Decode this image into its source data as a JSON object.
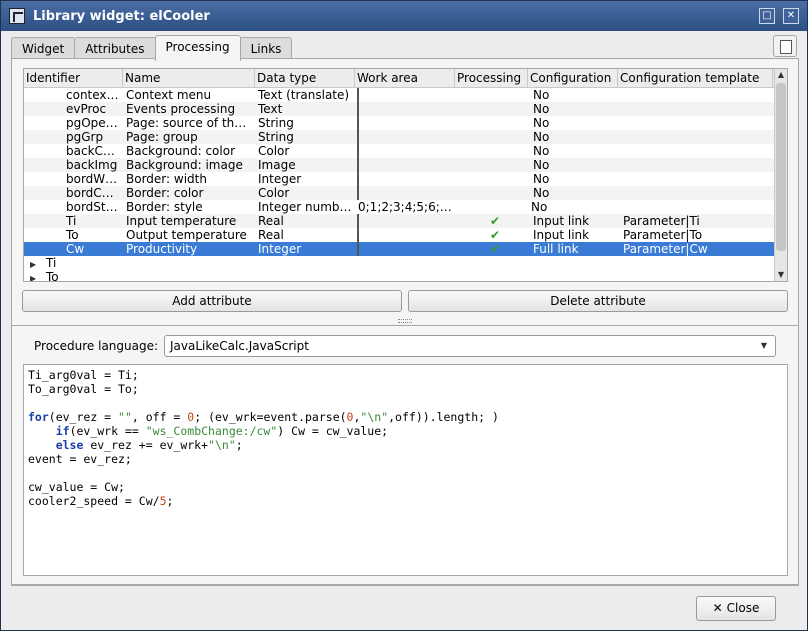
{
  "window": {
    "title": "Library widget: elCooler",
    "maximize_icon": "maximize-icon",
    "close_icon": "close-icon"
  },
  "tabs": [
    {
      "label": "Widget"
    },
    {
      "label": "Attributes"
    },
    {
      "label": "Processing",
      "active": true
    },
    {
      "label": "Links"
    }
  ],
  "table": {
    "headers": [
      "Identifier",
      "Name",
      "Data type",
      "Work area",
      "Processing",
      "Configuration",
      "Configuration template"
    ],
    "rows": [
      {
        "id": "contex…",
        "name": "Context menu",
        "type": "Text (translate)",
        "work": "",
        "proc": false,
        "conf": "No",
        "tmpl": ""
      },
      {
        "id": "evProc",
        "name": "Events processing",
        "type": "Text",
        "work": "",
        "proc": false,
        "conf": "No",
        "tmpl": ""
      },
      {
        "id": "pgOpe…",
        "name": "Page: source of th…",
        "type": "String",
        "work": "",
        "proc": false,
        "conf": "No",
        "tmpl": ""
      },
      {
        "id": "pgGrp",
        "name": "Page: group",
        "type": "String",
        "work": "",
        "proc": false,
        "conf": "No",
        "tmpl": ""
      },
      {
        "id": "backC…",
        "name": "Background: color",
        "type": "Color",
        "work": "",
        "proc": false,
        "conf": "No",
        "tmpl": ""
      },
      {
        "id": "backImg",
        "name": "Background: image",
        "type": "Image",
        "work": "",
        "proc": false,
        "conf": "No",
        "tmpl": ""
      },
      {
        "id": "bordW…",
        "name": "Border: width",
        "type": "Integer",
        "work": "",
        "proc": false,
        "conf": "No",
        "tmpl": ""
      },
      {
        "id": "bordC…",
        "name": "Border: color",
        "type": "Color",
        "work": "",
        "proc": false,
        "conf": "No",
        "tmpl": ""
      },
      {
        "id": "bordSt…",
        "name": "Border: style",
        "type": "Integer numb…",
        "work": "0;1;2;3;4;5;6;…",
        "proc": false,
        "conf": "No",
        "tmpl": ""
      },
      {
        "id": "Ti",
        "name": "Input temperature",
        "type": "Real",
        "work": "",
        "proc": true,
        "conf": "Input link",
        "tmpl": "Parameter|Ti"
      },
      {
        "id": "To",
        "name": "Output temperature",
        "type": "Real",
        "work": "",
        "proc": true,
        "conf": "Input link",
        "tmpl": "Parameter|To"
      },
      {
        "id": "Cw",
        "name": "Productivity",
        "type": "Integer",
        "work": "",
        "proc": true,
        "conf": "Full link",
        "tmpl": "Parameter|Cw",
        "selected": true
      }
    ],
    "tree": [
      "Ti",
      "To"
    ]
  },
  "buttons": {
    "add": "Add attribute",
    "delete": "Delete attribute",
    "close": "Close"
  },
  "procedure": {
    "label": "Procedure language:",
    "language": "JavaLikeCalc.JavaScript"
  },
  "code_lines": [
    "Ti_arg0val = Ti;",
    "To_arg0val = To;",
    "",
    "for(ev_rez = \"\", off = 0; (ev_wrk=event.parse(0,\"\\n\",off)).length; )",
    "    if(ev_wrk == \"ws_CombChange:/cw\") Cw = cw_value;",
    "    else ev_rez += ev_wrk+\"\\n\";",
    "event = ev_rez;",
    "",
    "cw_value = Cw;",
    "cooler2_speed = Cw/5;"
  ]
}
